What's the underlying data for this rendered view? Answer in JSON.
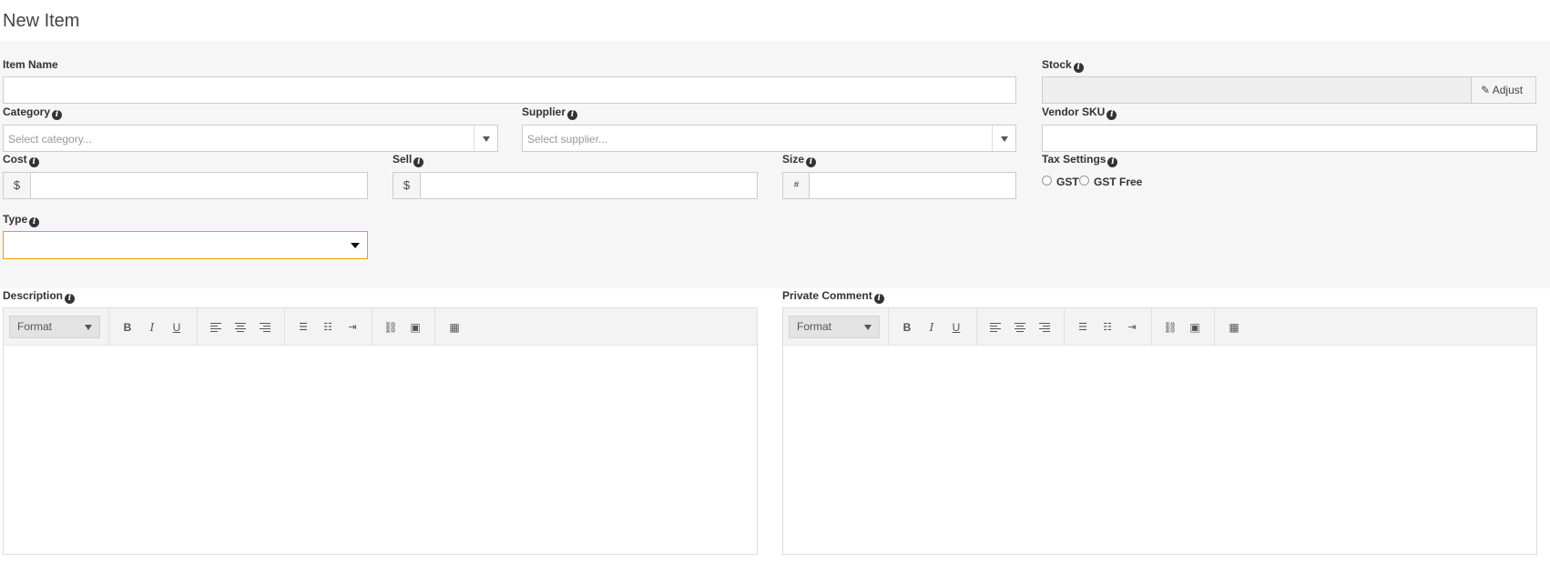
{
  "page": {
    "title": "New Item"
  },
  "form": {
    "item_name": {
      "label": "Item Name",
      "value": ""
    },
    "stock": {
      "label": "Stock",
      "value": "",
      "adjust_label": "Adjust"
    },
    "category": {
      "label": "Category",
      "placeholder": "Select category..."
    },
    "supplier": {
      "label": "Supplier",
      "placeholder": "Select supplier..."
    },
    "vendor_sku": {
      "label": "Vendor SKU",
      "value": ""
    },
    "cost": {
      "label": "Cost",
      "prefix": "$",
      "value": ""
    },
    "sell": {
      "label": "Sell",
      "prefix": "$",
      "value": ""
    },
    "size": {
      "label": "Size",
      "prefix": "#",
      "value": ""
    },
    "tax_settings": {
      "label": "Tax Settings",
      "options": [
        "GST",
        "GST Free"
      ]
    },
    "type": {
      "label": "Type",
      "value": ""
    }
  },
  "editors": {
    "description": {
      "label": "Description",
      "format_label": "Format",
      "content": ""
    },
    "private_comment": {
      "label": "Private Comment",
      "format_label": "Format",
      "content": ""
    }
  },
  "colors": {
    "panel_bg": "#f6f6f6",
    "focus_border": "#e8a200"
  },
  "icons": [
    "info-icon",
    "edit-icon",
    "bold-icon",
    "italic-icon",
    "underline-icon",
    "align-left-icon",
    "align-center-icon",
    "align-right-icon",
    "bullet-list-icon",
    "numbered-list-icon",
    "indent-icon",
    "link-icon",
    "image-icon",
    "table-icon"
  ]
}
